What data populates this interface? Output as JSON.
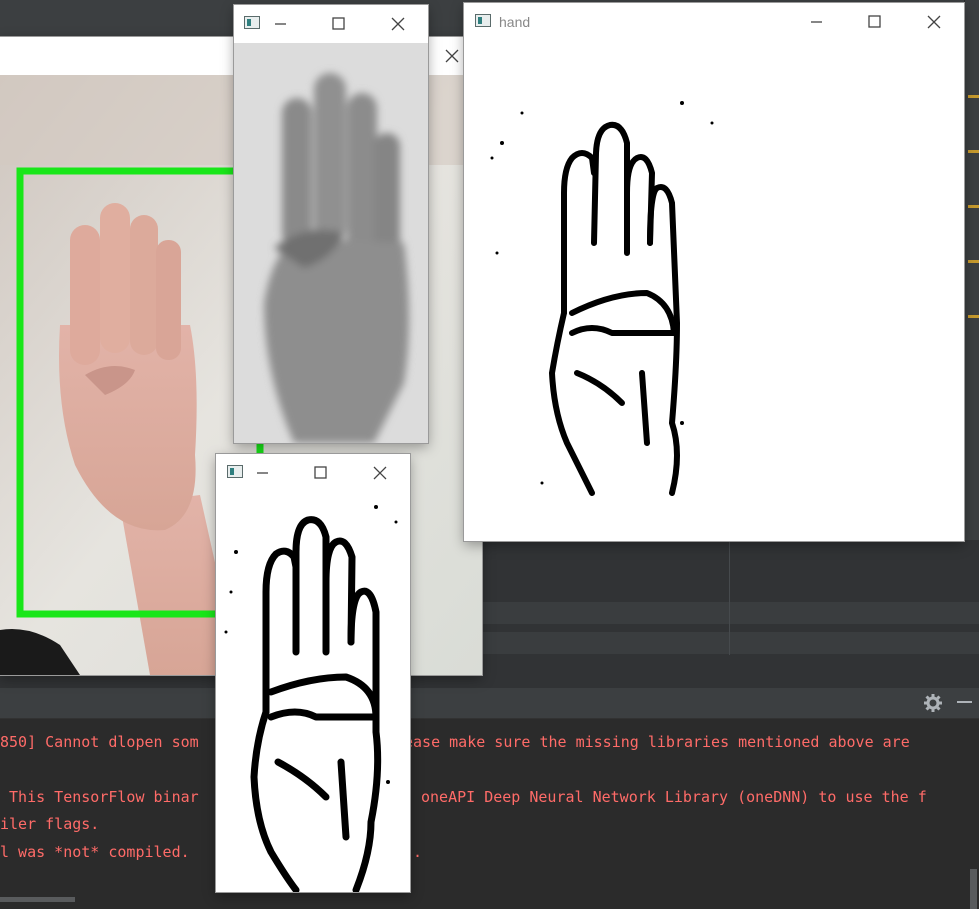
{
  "console": {
    "lines": [
      "850] Cannot dlopen som",
      "ease make sure the missing libraries mentioned above are",
      " This TensorFlow binar",
      "oneAPI Deep Neural Network Library (oneDNN) to use the f",
      "iler flags.",
      "l was *not* compiled."
    ],
    "dotted_tail": "."
  },
  "windows": {
    "hand": {
      "title": "hand"
    }
  },
  "icons": {
    "app": "opencv-window-icon",
    "min": "minimize-icon",
    "max": "maximize-icon",
    "close": "close-icon",
    "gear": "gear-icon",
    "hide": "hide-panel-icon"
  },
  "colors": {
    "bounding_box": "#19e619",
    "console_error": "#ff6b68"
  }
}
